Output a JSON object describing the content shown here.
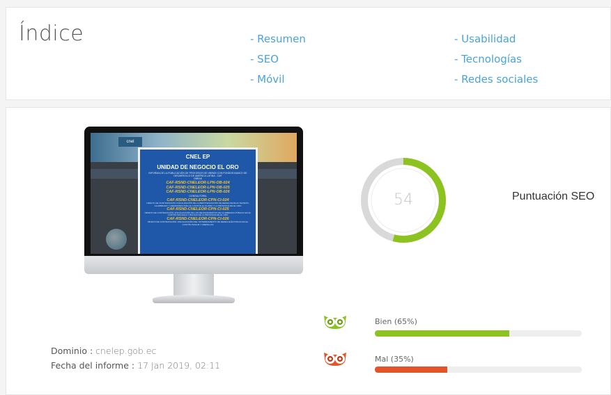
{
  "index": {
    "title": "Índice",
    "col1": [
      "- Resumen",
      "- SEO",
      "- Móvil"
    ],
    "col2": [
      "- Usabilidad",
      "- Tecnologías",
      "- Redes sociales"
    ]
  },
  "preview": {
    "logo": "cnel",
    "modal": {
      "title1": "CNEL EP",
      "title2": "UNIDAD DE NEGOCIO EL ORO",
      "intro": "INFORMA DE LA PUBLICACIÓN DE PROCESOS DE OBRAS CON FONDOS BANCO DE DESARROLLO DE AMÉRICA LATINA - CAF",
      "obras": "OBRAS",
      "codes_obras": [
        "CAF-RSND-CNELEOR-LPN-OB-024",
        "CAF-RSND-CNELEOR-LPN-OB-025",
        "CAF-RSND-CNELEOR-LPN-OB-026"
      ],
      "consultoria": "CONSULTORÍA",
      "codes_cons": [
        {
          "code": "CAF-RSND-CNELEOR-CPN-CI-024",
          "desc": "OBJETO DE CONTRATACIÓN: FISCALIZACIÓN DE LA REPOTENCIACIÓN DE REDES DE BAJA TENSIÓN, ALUMBRADO Y MEDIDORES PARA EL CANTÓN EL GUABO Y LA PROVINCIA DE EL ORO"
        },
        {
          "code": "CAF-RSND-CNELEOR-CPN-CI-025",
          "desc": "OBJETO DE CONTRATACIÓN: FISCALIZACIÓN DE LOS MEJORAMIENTOS DE ALUMBRADO PÚBLICO EN EL CANTÓN MACHALA Y BALSAS DE LA PROVINCIA DE EL ORO"
        },
        {
          "code": "CAF-RSND-CNELEOR-CPN-CI-026",
          "desc": "OBJETO DE CONTRATACIÓN: FISCALIZACIÓN DEL SOTERRAMIENTO DE REDES ELÉCTRICAS EN EL CANTÓN PASAJE Y ARENILLAS"
        }
      ]
    }
  },
  "score": {
    "value": "54",
    "fraction": 0.54,
    "label": "Puntuación SEO",
    "color_fill": "#8cc320",
    "color_track": "#d9d9d9"
  },
  "bars": [
    {
      "label": "Bien (65%)",
      "percent": 65,
      "color": "#8cc320",
      "icon": "happy-owl-icon"
    },
    {
      "label": "Mal (35%)",
      "percent": 35,
      "color": "#e5532a",
      "icon": "sad-owl-icon"
    }
  ],
  "meta": {
    "domain_key": "Dominio",
    "domain_value": "cnelep.gob.ec",
    "date_key": "Fecha del informe",
    "date_value": "17 Jan 2019, 02:11"
  }
}
